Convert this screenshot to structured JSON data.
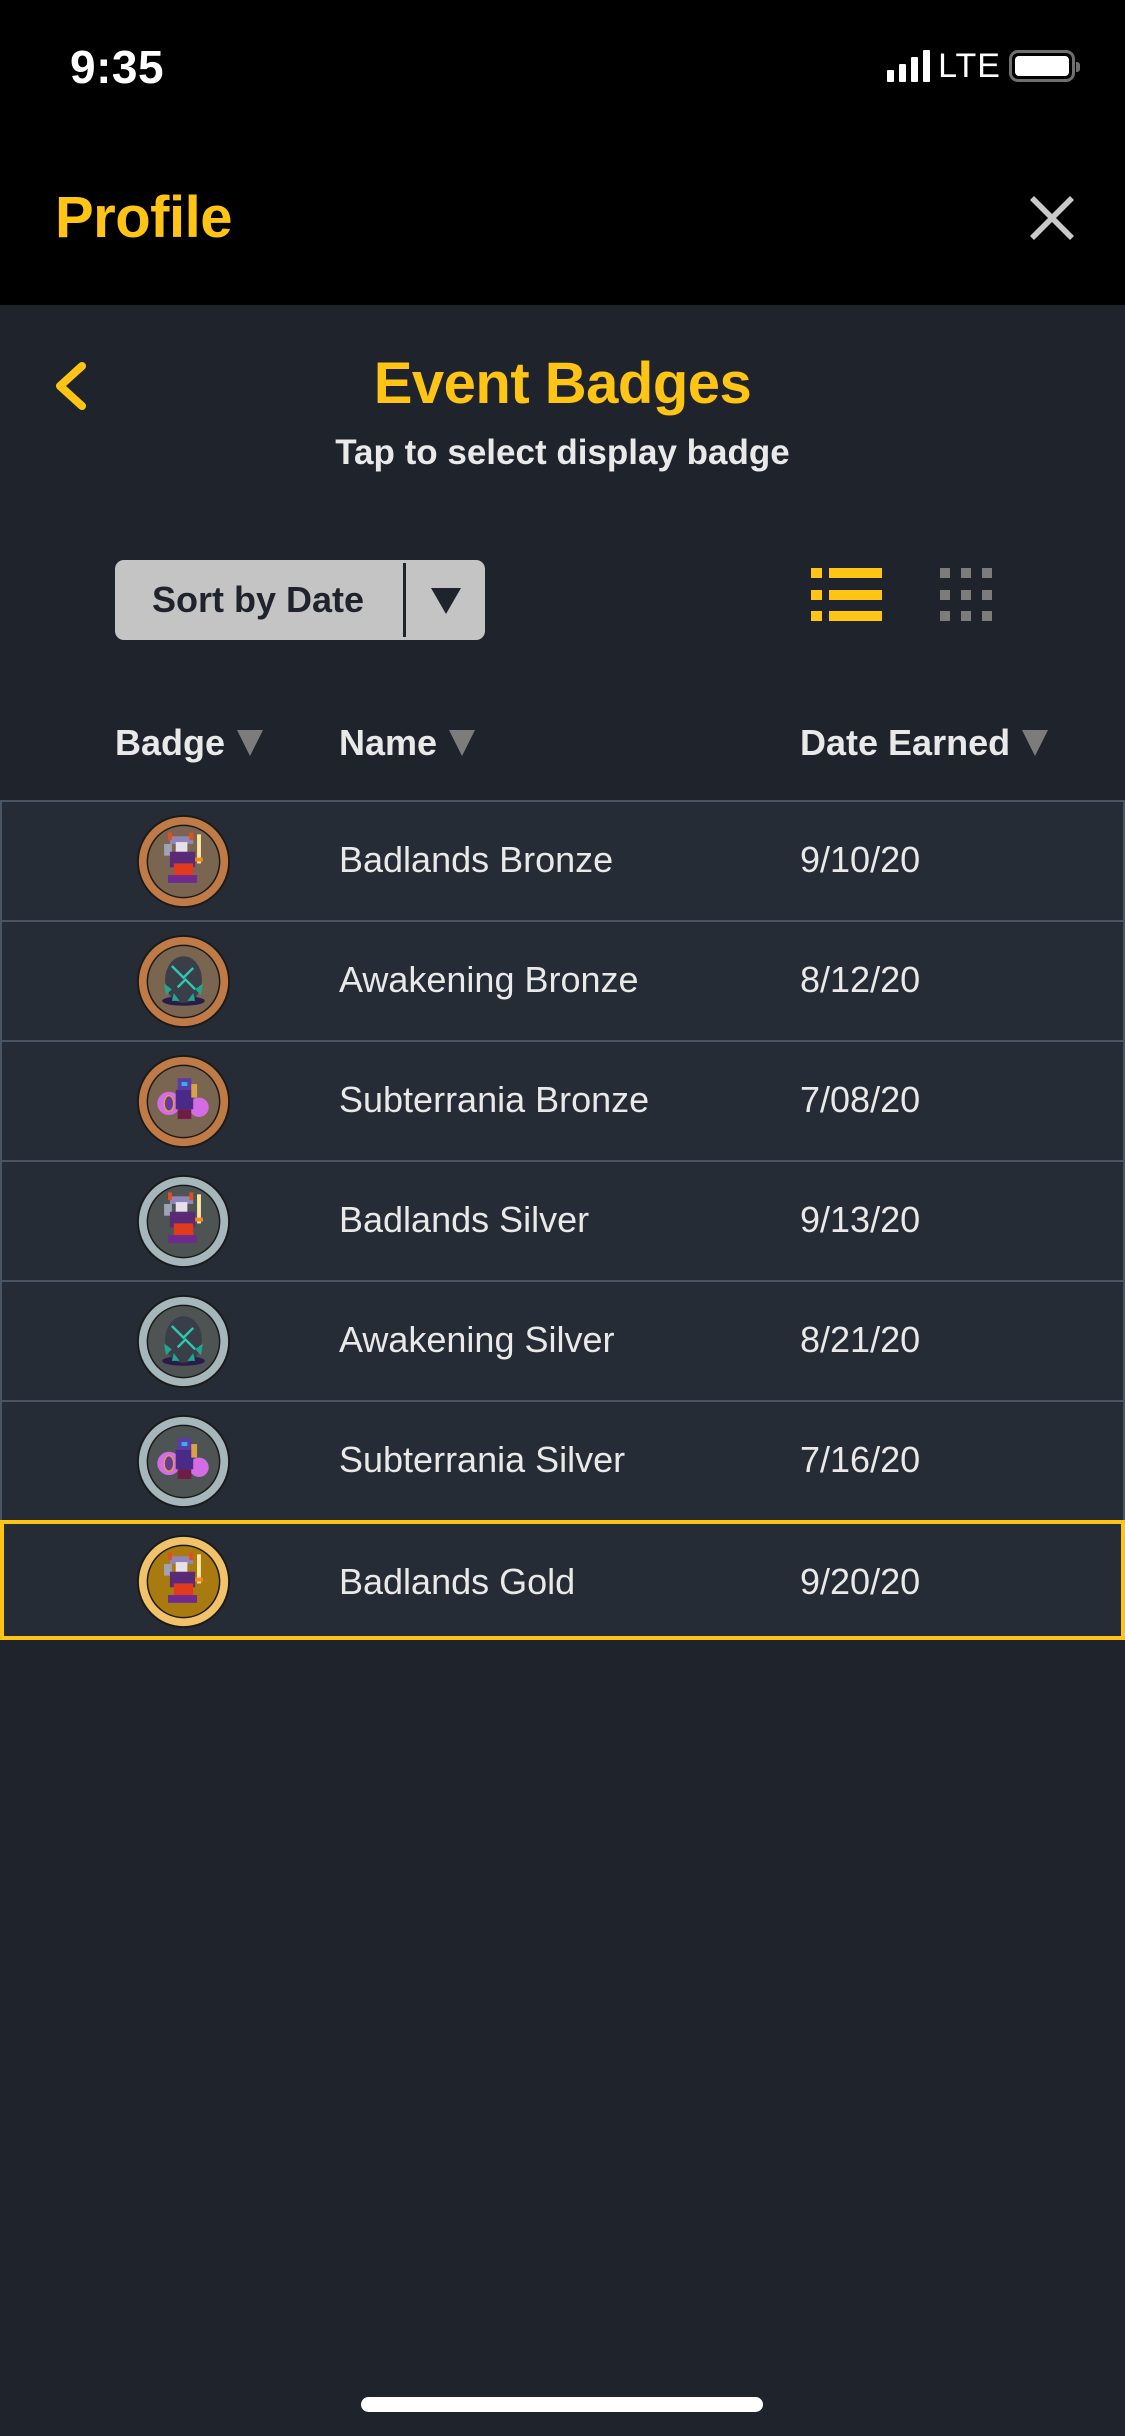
{
  "status_bar": {
    "time": "9:35",
    "network": "LTE",
    "signal_bars": 4,
    "battery_level": 1.0
  },
  "header": {
    "title": "Profile",
    "close_icon": "close-x-icon"
  },
  "page": {
    "back_icon": "chevron-left-icon",
    "title": "Event Badges",
    "subtitle": "Tap to select display badge"
  },
  "toolbar": {
    "sort_label": "Sort by Date",
    "sort_icon": "caret-down-icon",
    "view_modes": [
      {
        "name": "list",
        "icon": "list-view-icon",
        "active": true
      },
      {
        "name": "grid",
        "icon": "grid-view-icon",
        "active": false
      }
    ]
  },
  "table": {
    "columns": [
      {
        "label": "Badge",
        "icon": "sort-caret-icon"
      },
      {
        "label": "Name",
        "icon": "sort-caret-icon"
      },
      {
        "label": "Date Earned",
        "icon": "sort-caret-icon"
      }
    ],
    "rows": [
      {
        "badge": "badlands-bronze-badge-icon",
        "tier": "bronze",
        "art": "warrior",
        "name": "Badlands Bronze",
        "date": "9/10/20",
        "selected": false
      },
      {
        "badge": "awakening-bronze-badge-icon",
        "tier": "bronze",
        "art": "egg",
        "name": "Awakening Bronze",
        "date": "8/12/20",
        "selected": false
      },
      {
        "badge": "subterrania-bronze-badge-icon",
        "tier": "bronze",
        "art": "crystal",
        "name": "Subterrania Bronze",
        "date": "7/08/20",
        "selected": false
      },
      {
        "badge": "badlands-silver-badge-icon",
        "tier": "silver",
        "art": "warrior",
        "name": "Badlands Silver",
        "date": "9/13/20",
        "selected": false
      },
      {
        "badge": "awakening-silver-badge-icon",
        "tier": "silver",
        "art": "egg",
        "name": "Awakening Silver",
        "date": "8/21/20",
        "selected": false
      },
      {
        "badge": "subterrania-silver-badge-icon",
        "tier": "silver",
        "art": "crystal",
        "name": "Subterrania Silver",
        "date": "7/16/20",
        "selected": false
      },
      {
        "badge": "badlands-gold-badge-icon",
        "tier": "gold",
        "art": "warrior",
        "name": "Badlands Gold",
        "date": "9/20/20",
        "selected": true
      }
    ]
  },
  "colors": {
    "accent": "#FFC414",
    "background": "#1F242C",
    "row_background": "#262C35",
    "row_border": "#4A5563",
    "header_background": "#000000",
    "tiers": {
      "bronze": {
        "ring": "#C07A45",
        "inner": "#7A6550"
      },
      "silver": {
        "ring": "#A6B7BC",
        "inner": "#4E5353"
      },
      "gold": {
        "ring": "#F2C26A",
        "inner": "#A97A10"
      }
    }
  }
}
